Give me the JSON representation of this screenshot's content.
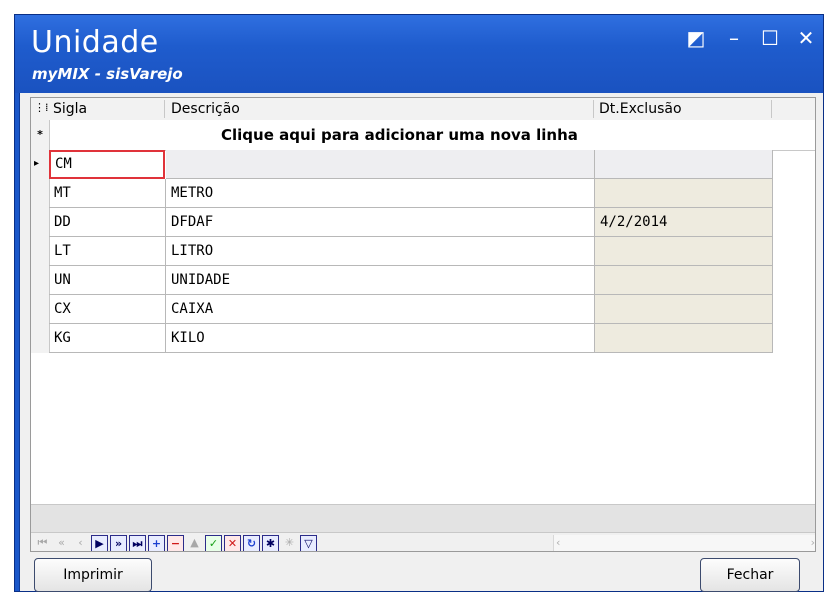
{
  "window": {
    "title": "Unidade",
    "subtitle": "myMIX - sisVarejo"
  },
  "controls": {
    "restore": "◩",
    "minimize": "–",
    "maximize": "☐",
    "close": "✕"
  },
  "grid": {
    "columns": [
      "Sigla",
      "Descrição",
      "Dt.Exclusão"
    ],
    "new_row_text": "Clique aqui para adicionar uma nova linha",
    "new_row_marker": "*",
    "editing_row": {
      "sigla": "CM",
      "descricao": "",
      "dt_exclusao": ""
    },
    "rows": [
      {
        "sigla": "MT",
        "descricao": "METRO",
        "dt_exclusao": ""
      },
      {
        "sigla": "DD",
        "descricao": "DFDAF",
        "dt_exclusao": "4/2/2014"
      },
      {
        "sigla": "LT",
        "descricao": "LITRO",
        "dt_exclusao": ""
      },
      {
        "sigla": "UN",
        "descricao": "UNIDADE",
        "dt_exclusao": ""
      },
      {
        "sigla": "CX",
        "descricao": "CAIXA",
        "dt_exclusao": ""
      },
      {
        "sigla": "KG",
        "descricao": "KILO",
        "dt_exclusao": ""
      }
    ]
  },
  "buttons": {
    "print": "Imprimir",
    "close": "Fechar"
  },
  "colors": {
    "title_bar": "#1f5ccd",
    "edit_highlight": "#e0333a",
    "readonly_cell": "#eeebdf"
  }
}
